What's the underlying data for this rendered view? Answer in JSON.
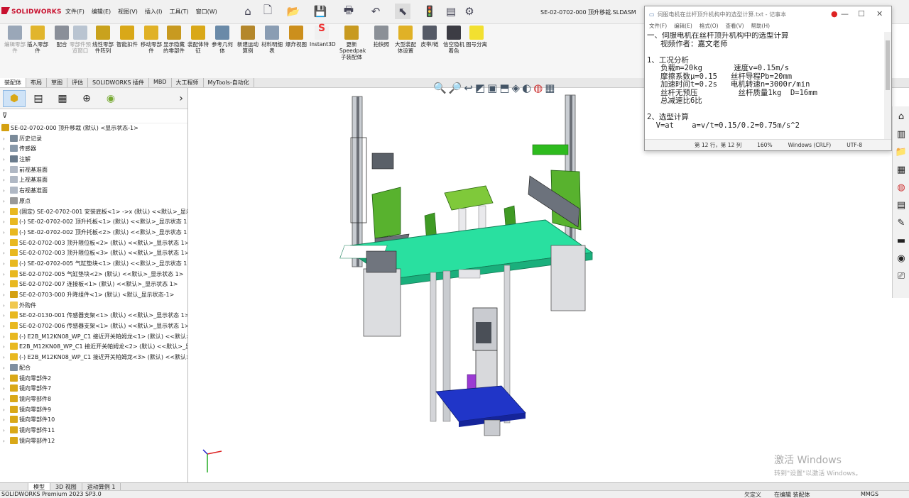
{
  "app": {
    "brand": "SOLIDWORKS",
    "doc_title": "SE-02-0702-000 顶升移栽.SLDASM"
  },
  "menu": [
    "文件(F)",
    "编辑(E)",
    "视图(V)",
    "插入(I)",
    "工具(T)",
    "窗口(W)"
  ],
  "ribbon": [
    {
      "label": "编辑零部件",
      "icon": "edit-component-icon",
      "disabled": true
    },
    {
      "label": "插入零部件",
      "icon": "insert-component-icon"
    },
    {
      "label": "配合",
      "icon": "mate-icon"
    },
    {
      "label": "零部件预览窗口",
      "icon": "preview-window-icon",
      "disabled": true
    },
    {
      "label": "线性零部件阵列",
      "icon": "linear-pattern-icon"
    },
    {
      "label": "智能扣件",
      "icon": "smart-fastener-icon"
    },
    {
      "label": "移动零部件",
      "icon": "move-component-icon"
    },
    {
      "label": "显示隐藏的零部件",
      "icon": "show-hidden-icon"
    },
    {
      "label": "装配体特征",
      "icon": "assembly-feature-icon"
    },
    {
      "label": "参考几何体",
      "icon": "reference-geometry-icon"
    },
    {
      "label": "新建运动算例",
      "icon": "motion-study-icon"
    },
    {
      "label": "材料明细表",
      "icon": "bom-icon"
    },
    {
      "label": "爆炸视图",
      "icon": "explode-view-icon"
    },
    {
      "label": "Instant3D",
      "icon": "instant3d-icon"
    },
    {
      "label": "更新Speedpak子装配体",
      "icon": "speedpak-icon"
    },
    {
      "label": "拍快照",
      "icon": "snapshot-icon"
    },
    {
      "label": "大型装配体设置",
      "icon": "large-assembly-icon"
    },
    {
      "label": "皮带/链",
      "icon": "belt-chain-icon"
    },
    {
      "label": "信空隐机着色",
      "icon": "shading-icon"
    },
    {
      "label": "图号分离",
      "icon": "smiley-icon"
    }
  ],
  "tabs": [
    "装配体",
    "布局",
    "草图",
    "评估",
    "SOLIDWORKS 插件",
    "MBD",
    "大工程师",
    "MyTools-自动化"
  ],
  "tree": {
    "root": "SE-02-0702-000 顶升移栽 (默认) <显示状态-1>",
    "items": [
      {
        "label": "历史记录",
        "icon": "history-icon",
        "color": "#7a8a99"
      },
      {
        "label": "传感器",
        "icon": "sensor-icon",
        "color": "#8899aa"
      },
      {
        "label": "注解",
        "icon": "annotation-icon",
        "color": "#6a7b8c"
      },
      {
        "label": "前视基准面",
        "icon": "plane-icon",
        "color": "#b0b8c4"
      },
      {
        "label": "上视基准面",
        "icon": "plane-icon",
        "color": "#b0b8c4"
      },
      {
        "label": "右视基准面",
        "icon": "plane-icon",
        "color": "#b0b8c4"
      },
      {
        "label": "原点",
        "icon": "origin-icon",
        "color": "#999999"
      },
      {
        "label": "(固定) SE-02-0702-001  安装底板<1> ->x (默认) <<默认>_显示状态 1>",
        "icon": "part-icon",
        "color": "#e8b820"
      },
      {
        "label": "(-) SE-02-0702-002 顶升托板<1> (默认) <<默认>_显示状态 1>",
        "icon": "part-icon",
        "color": "#e8b820"
      },
      {
        "label": "(-) SE-02-0702-002 顶升托板<2> (默认) <<默认>_显示状态 1>",
        "icon": "part-icon",
        "color": "#e8b820"
      },
      {
        "label": "SE-02-0702-003 顶升限位板<2> (默认) <<默认>_显示状态 1>",
        "icon": "part-icon",
        "color": "#e8b820"
      },
      {
        "label": "SE-02-0702-003 顶升限位板<3> (默认) <<默认>_显示状态 1>",
        "icon": "part-icon",
        "color": "#e8b820"
      },
      {
        "label": "(-) SE-02-0702-005 气缸垫块<1> (默认) <<默认>_显示状态 1>",
        "icon": "part-icon",
        "color": "#e8b820"
      },
      {
        "label": "SE-02-0702-005 气缸垫块<2> (默认) <<默认>_显示状态 1>",
        "icon": "part-icon",
        "color": "#e8b820"
      },
      {
        "label": "SE-02-0702-007 连接板<1> (默认) <<默认>_显示状态 1>",
        "icon": "part-icon",
        "color": "#e8b820"
      },
      {
        "label": "SE-02-0703-000  升降组件<1> (默认) <默认_显示状态-1>",
        "icon": "assembly-icon",
        "color": "#d4a010"
      },
      {
        "label": "外购件",
        "icon": "folder-icon",
        "color": "#f0c850"
      },
      {
        "label": "SE-02-0130-001 传感器支架<1> (默认) <<默认>_显示状态 1>",
        "icon": "part-icon",
        "color": "#e8b820"
      },
      {
        "label": "SE-02-0702-006 传感器支架<1> (默认) <<默认>_显示状态 1>",
        "icon": "part-icon",
        "color": "#e8b820"
      },
      {
        "label": "(-) E2B_M12KN08_WP_C1 接近开关帕姆龙<1> (默认) <<默认>_",
        "icon": "part-icon",
        "color": "#e8b820"
      },
      {
        "label": "E2B_M12KN08_WP_C1 接近开关帕姆龙<2> (默认) <<默认>_显",
        "icon": "part-icon",
        "color": "#e8b820"
      },
      {
        "label": "(-) E2B_M12KN08_WP_C1 接近开关帕姆龙<3> (默认) <<默认>_",
        "icon": "part-icon",
        "color": "#e8b820"
      },
      {
        "label": "配合",
        "icon": "mates-icon",
        "color": "#7f8fa0"
      },
      {
        "label": "镜向零部件2",
        "icon": "mirror-icon",
        "color": "#d9a818"
      },
      {
        "label": "镜向零部件7",
        "icon": "mirror-icon",
        "color": "#d9a818"
      },
      {
        "label": "镜向零部件8",
        "icon": "mirror-icon",
        "color": "#d9a818"
      },
      {
        "label": "镜向零部件9",
        "icon": "mirror-icon",
        "color": "#d9a818"
      },
      {
        "label": "镜向零部件10",
        "icon": "mirror-icon",
        "color": "#d9a818"
      },
      {
        "label": "镜向零部件11",
        "icon": "mirror-icon",
        "color": "#d9a818"
      },
      {
        "label": "镜向零部件12",
        "icon": "mirror-icon",
        "color": "#d9a818"
      }
    ]
  },
  "notepad": {
    "title": "伺服电机在丝杆顶升机构中的选型计算.txt - 记事本",
    "menu": [
      "文件(F)",
      "编辑(E)",
      "格式(O)",
      "查看(V)",
      "帮助(H)"
    ],
    "lines": [
      "一、伺服电机在丝杆顶升机构中的选型计算",
      "   视频作者：嘉文老师",
      "",
      "1、工况分析",
      "   负载m=20kg       速度v=0.15m/s",
      "   摩擦系数μ=0.15   丝杆导程Pb=20mm",
      "   加速时间t=0.2s   电机转速n=3000r/min",
      "   丝杆无预压         丝杆质量1kg  D=16mm",
      "   总减速比6比",
      "",
      "2、选型计算",
      "  V=at    a=v/t=0.15/0.2=0.75m/s^2"
    ],
    "status": {
      "pos": "第 12 行，第 12 列",
      "zoom": "160%",
      "eol": "Windows (CRLF)",
      "enc": "UTF-8"
    }
  },
  "bottom_tabs": [
    "模型",
    "3D 视图",
    "运动算例 1"
  ],
  "status": {
    "product": "SOLIDWORKS Premium 2023 SP3.0",
    "state": "欠定义",
    "editing": "在编辑 装配体",
    "units": "MMGS"
  },
  "watermark": {
    "line1": "激活 Windows",
    "line2": "转到\"设置\"以激活 Windows。"
  }
}
